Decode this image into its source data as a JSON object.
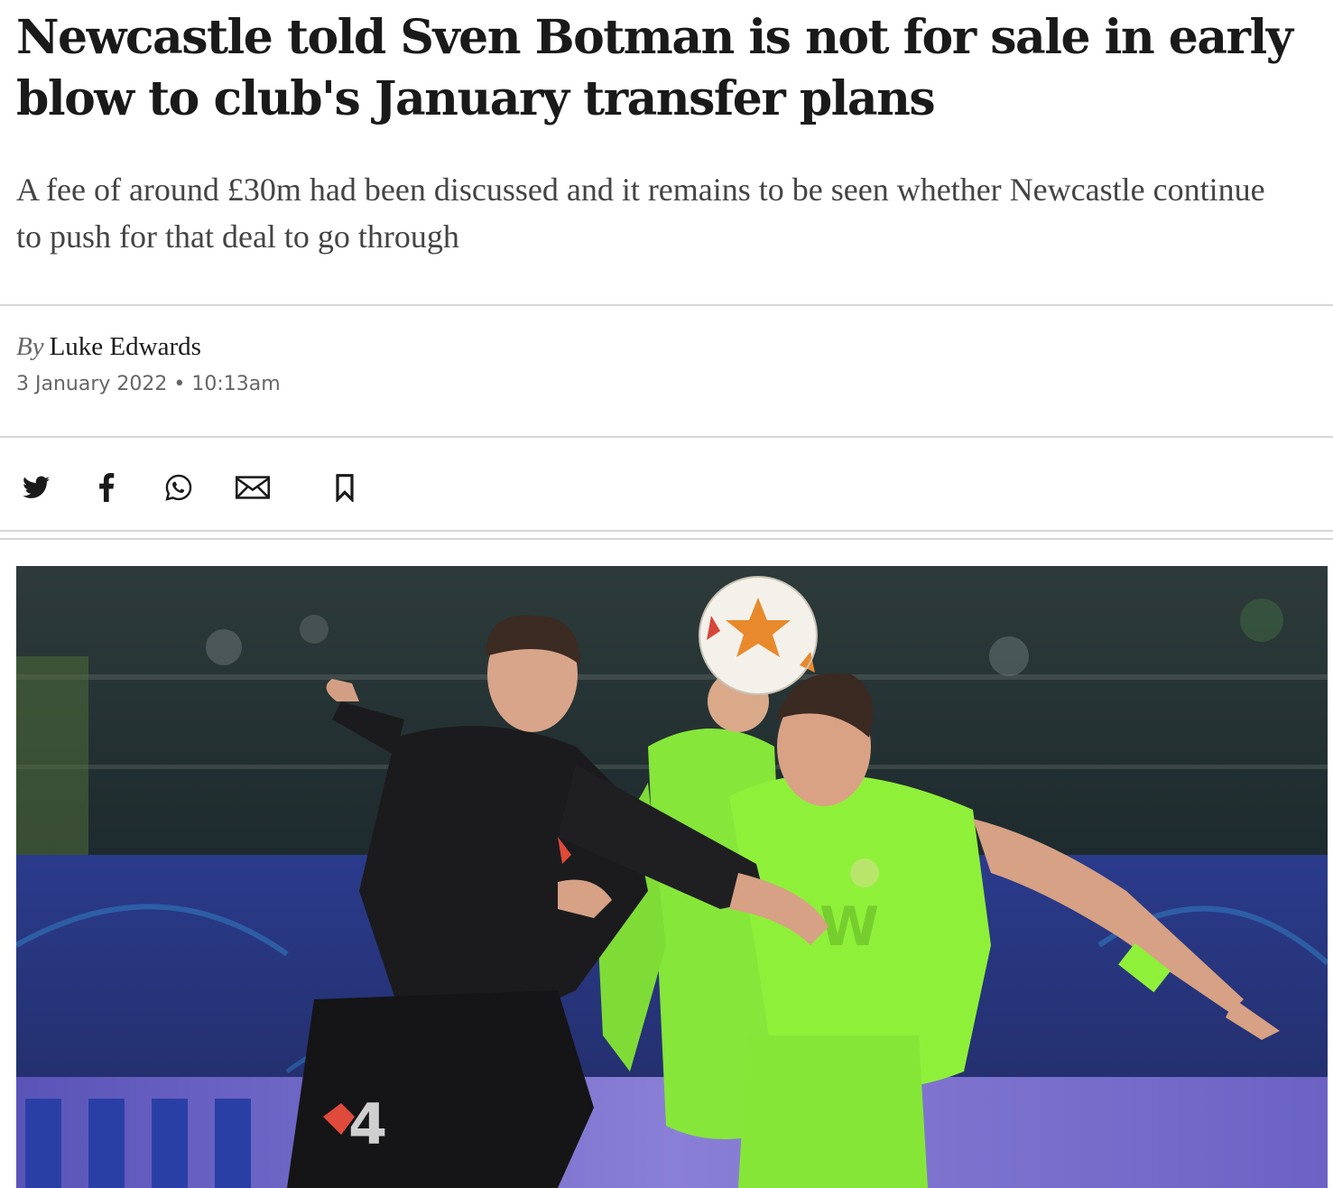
{
  "article": {
    "headline": "Newcastle told Sven Botman is not for sale in early blow to club's January transfer plans",
    "standfirst": "A fee of around £30m had been discussed and it remains to be seen whether Newcastle continue to push for that deal to go through",
    "byline": {
      "prefix": "By",
      "author": "Luke Edwards"
    },
    "date": "3 January 2022",
    "separator": "•",
    "time": "10:13am"
  },
  "share_bar": {
    "items": [
      {
        "name": "twitter",
        "icon": "twitter-icon"
      },
      {
        "name": "facebook",
        "icon": "facebook-icon"
      },
      {
        "name": "whatsapp",
        "icon": "whatsapp-icon"
      },
      {
        "name": "email",
        "icon": "email-icon"
      },
      {
        "name": "bookmark",
        "icon": "bookmark-icon"
      }
    ]
  },
  "lead_image": {
    "shirt_number": "4",
    "colors": {
      "pitch_board": "#2a3a8a",
      "kit_green": "#8ff03a",
      "kit_black": "#1b1b1d"
    }
  }
}
